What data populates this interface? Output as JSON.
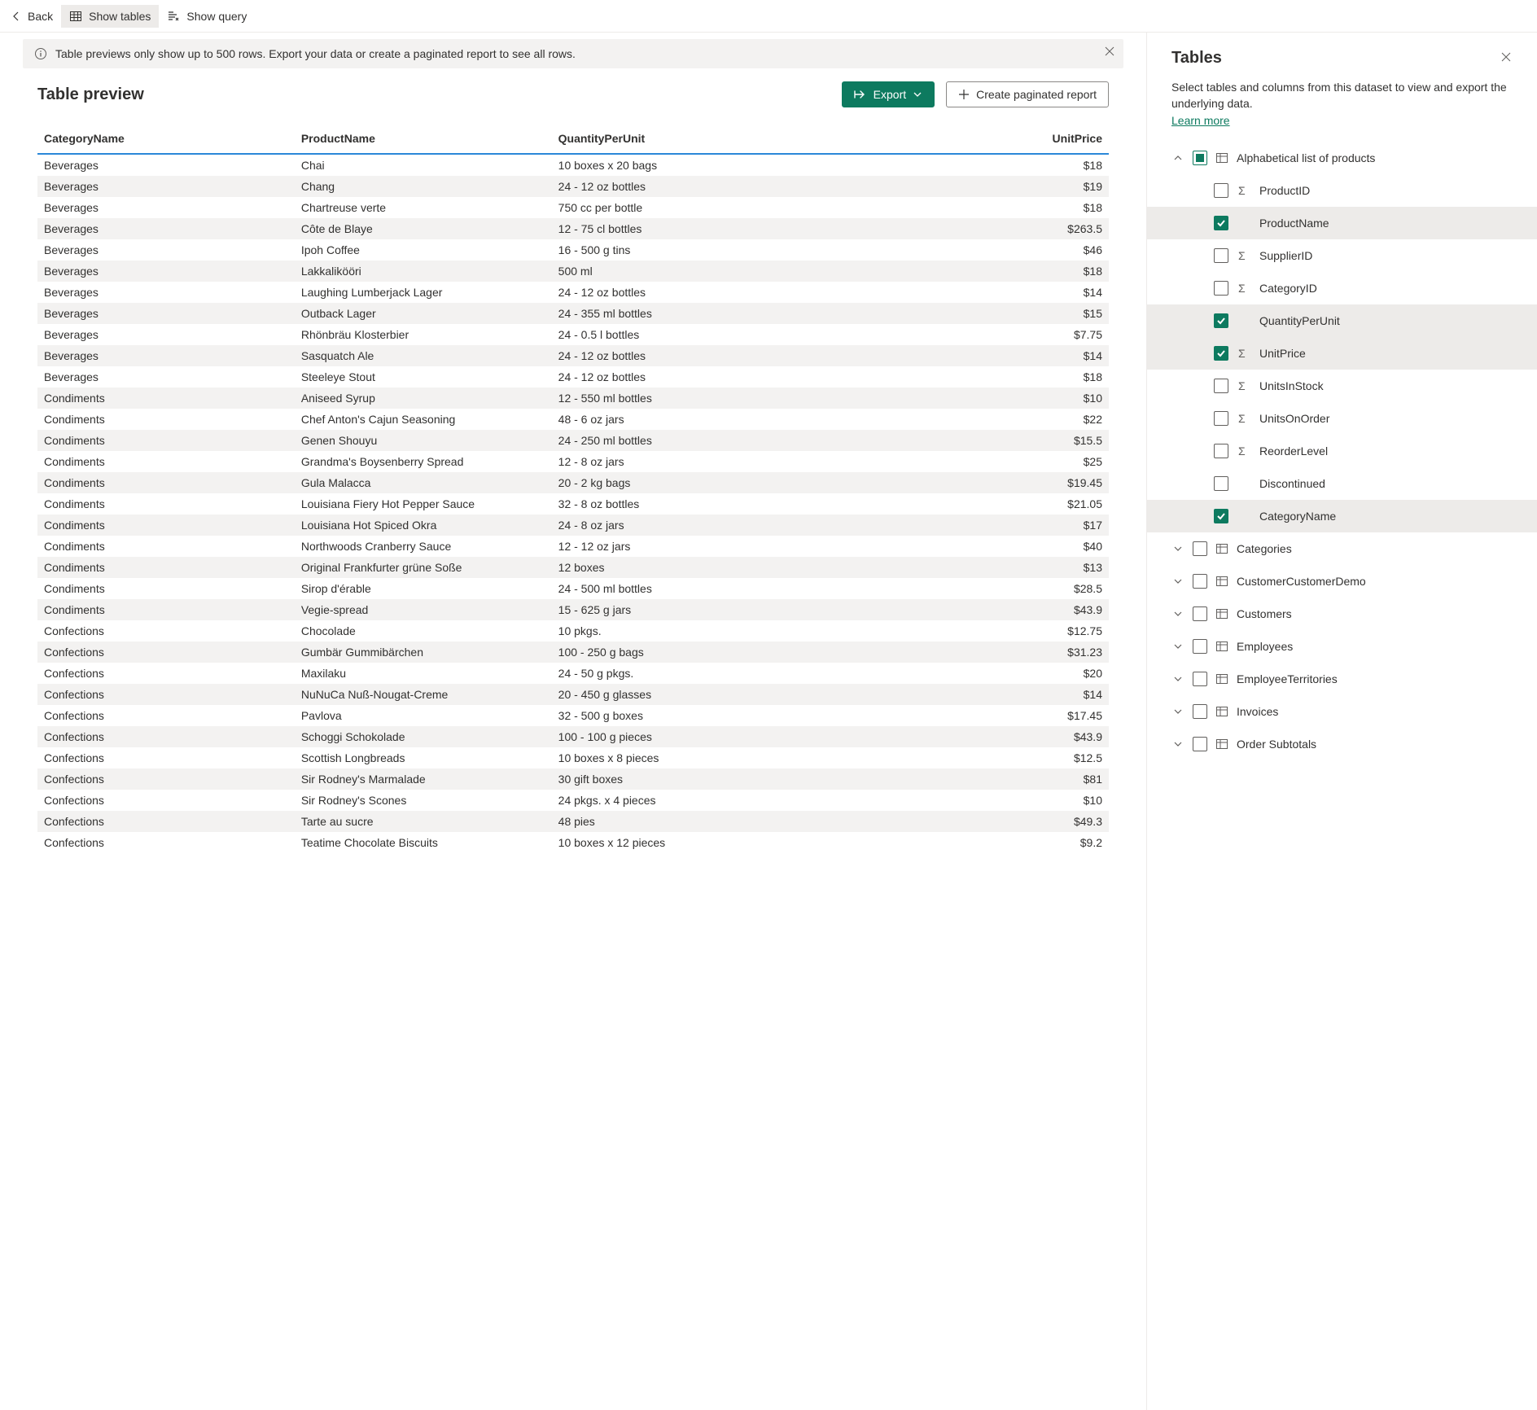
{
  "toolbar": {
    "back": "Back",
    "show_tables": "Show tables",
    "show_query": "Show query"
  },
  "info_bar": {
    "text": "Table previews only show up to 500 rows. Export your data or create a paginated report to see all rows."
  },
  "preview": {
    "title": "Table preview",
    "export_label": "Export",
    "create_report_label": "Create paginated report"
  },
  "columns": [
    "CategoryName",
    "ProductName",
    "QuantityPerUnit",
    "UnitPrice"
  ],
  "rows": [
    [
      "Beverages",
      "Chai",
      "10 boxes x 20 bags",
      "$18"
    ],
    [
      "Beverages",
      "Chang",
      "24 - 12 oz bottles",
      "$19"
    ],
    [
      "Beverages",
      "Chartreuse verte",
      "750 cc per bottle",
      "$18"
    ],
    [
      "Beverages",
      "Côte de Blaye",
      "12 - 75 cl bottles",
      "$263.5"
    ],
    [
      "Beverages",
      "Ipoh Coffee",
      "16 - 500 g tins",
      "$46"
    ],
    [
      "Beverages",
      "Lakkalikööri",
      "500 ml",
      "$18"
    ],
    [
      "Beverages",
      "Laughing Lumberjack Lager",
      "24 - 12 oz bottles",
      "$14"
    ],
    [
      "Beverages",
      "Outback Lager",
      "24 - 355 ml bottles",
      "$15"
    ],
    [
      "Beverages",
      "Rhönbräu Klosterbier",
      "24 - 0.5 l bottles",
      "$7.75"
    ],
    [
      "Beverages",
      "Sasquatch Ale",
      "24 - 12 oz bottles",
      "$14"
    ],
    [
      "Beverages",
      "Steeleye Stout",
      "24 - 12 oz bottles",
      "$18"
    ],
    [
      "Condiments",
      "Aniseed Syrup",
      "12 - 550 ml bottles",
      "$10"
    ],
    [
      "Condiments",
      "Chef Anton's Cajun Seasoning",
      "48 - 6 oz jars",
      "$22"
    ],
    [
      "Condiments",
      "Genen Shouyu",
      "24 - 250 ml bottles",
      "$15.5"
    ],
    [
      "Condiments",
      "Grandma's Boysenberry Spread",
      "12 - 8 oz jars",
      "$25"
    ],
    [
      "Condiments",
      "Gula Malacca",
      "20 - 2 kg bags",
      "$19.45"
    ],
    [
      "Condiments",
      "Louisiana Fiery Hot Pepper Sauce",
      "32 - 8 oz bottles",
      "$21.05"
    ],
    [
      "Condiments",
      "Louisiana Hot Spiced Okra",
      "24 - 8 oz jars",
      "$17"
    ],
    [
      "Condiments",
      "Northwoods Cranberry Sauce",
      "12 - 12 oz jars",
      "$40"
    ],
    [
      "Condiments",
      "Original Frankfurter grüne Soße",
      "12 boxes",
      "$13"
    ],
    [
      "Condiments",
      "Sirop d'érable",
      "24 - 500 ml bottles",
      "$28.5"
    ],
    [
      "Condiments",
      "Vegie-spread",
      "15 - 625 g jars",
      "$43.9"
    ],
    [
      "Confections",
      "Chocolade",
      "10 pkgs.",
      "$12.75"
    ],
    [
      "Confections",
      "Gumbär Gummibärchen",
      "100 - 250 g bags",
      "$31.23"
    ],
    [
      "Confections",
      "Maxilaku",
      "24 - 50 g pkgs.",
      "$20"
    ],
    [
      "Confections",
      "NuNuCa Nuß-Nougat-Creme",
      "20 - 450 g glasses",
      "$14"
    ],
    [
      "Confections",
      "Pavlova",
      "32 - 500 g boxes",
      "$17.45"
    ],
    [
      "Confections",
      "Schoggi Schokolade",
      "100 - 100 g pieces",
      "$43.9"
    ],
    [
      "Confections",
      "Scottish Longbreads",
      "10 boxes x 8 pieces",
      "$12.5"
    ],
    [
      "Confections",
      "Sir Rodney's Marmalade",
      "30 gift boxes",
      "$81"
    ],
    [
      "Confections",
      "Sir Rodney's Scones",
      "24 pkgs. x 4 pieces",
      "$10"
    ],
    [
      "Confections",
      "Tarte au sucre",
      "48 pies",
      "$49.3"
    ],
    [
      "Confections",
      "Teatime Chocolate Biscuits",
      "10 boxes x 12 pieces",
      "$9.2"
    ]
  ],
  "tables_panel": {
    "title": "Tables",
    "description": "Select tables and columns from this dataset to view and export the underlying data.",
    "learn_more": "Learn more",
    "expanded_table": {
      "name": "Alphabetical list of products",
      "fields": [
        {
          "name": "ProductID",
          "sigma": true,
          "checked": false
        },
        {
          "name": "ProductName",
          "sigma": false,
          "checked": true
        },
        {
          "name": "SupplierID",
          "sigma": true,
          "checked": false
        },
        {
          "name": "CategoryID",
          "sigma": true,
          "checked": false
        },
        {
          "name": "QuantityPerUnit",
          "sigma": false,
          "checked": true
        },
        {
          "name": "UnitPrice",
          "sigma": true,
          "checked": true
        },
        {
          "name": "UnitsInStock",
          "sigma": true,
          "checked": false
        },
        {
          "name": "UnitsOnOrder",
          "sigma": true,
          "checked": false
        },
        {
          "name": "ReorderLevel",
          "sigma": true,
          "checked": false
        },
        {
          "name": "Discontinued",
          "sigma": false,
          "checked": false
        },
        {
          "name": "CategoryName",
          "sigma": false,
          "checked": true
        }
      ]
    },
    "other_tables": [
      "Categories",
      "CustomerCustomerDemo",
      "Customers",
      "Employees",
      "EmployeeTerritories",
      "Invoices",
      "Order Subtotals"
    ]
  }
}
